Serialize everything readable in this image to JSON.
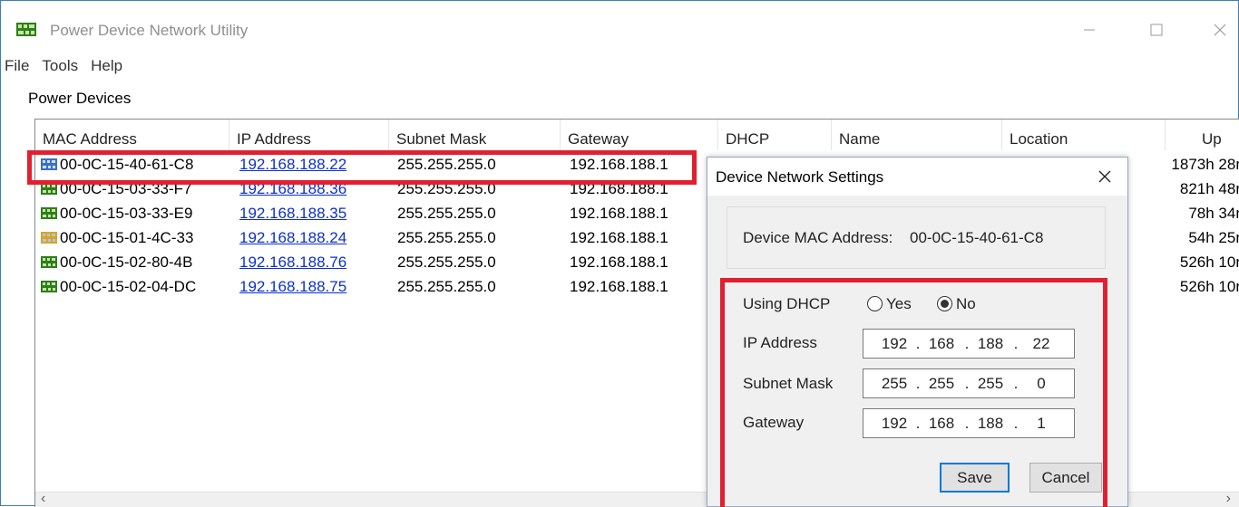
{
  "window": {
    "title": "Power Device Network Utility"
  },
  "menu": [
    "File",
    "Tools",
    "Help"
  ],
  "group_label": "Power Devices",
  "columns": [
    "MAC Address",
    "IP Address",
    "Subnet Mask",
    "Gateway",
    "DHCP",
    "Name",
    "Location",
    "Up"
  ],
  "rows": [
    {
      "mac": "00-0C-15-40-61-C8",
      "ip": "192.168.188.22",
      "subnet": "255.255.255.0",
      "gateway": "192.168.188.1",
      "uptime": "1873h 28r",
      "icon": "blue-device-icon"
    },
    {
      "mac": "00-0C-15-03-33-F7",
      "ip": "192.168.188.36",
      "subnet": "255.255.255.0",
      "gateway": "192.168.188.1",
      "uptime": "821h 48r",
      "icon": "green-device-icon"
    },
    {
      "mac": "00-0C-15-03-33-E9",
      "ip": "192.168.188.35",
      "subnet": "255.255.255.0",
      "gateway": "192.168.188.1",
      "uptime": "78h 34r",
      "icon": "green-device-icon"
    },
    {
      "mac": "00-0C-15-01-4C-33",
      "ip": "192.168.188.24",
      "subnet": "255.255.255.0",
      "gateway": "192.168.188.1",
      "uptime": "54h 25r",
      "icon": "yellow-device-icon"
    },
    {
      "mac": "00-0C-15-02-80-4B",
      "ip": "192.168.188.76",
      "subnet": "255.255.255.0",
      "gateway": "192.168.188.1",
      "uptime": "526h 10r",
      "icon": "green-device-icon"
    },
    {
      "mac": "00-0C-15-02-04-DC",
      "ip": "192.168.188.75",
      "subnet": "255.255.255.0",
      "gateway": "192.168.188.1",
      "uptime": "526h 10r",
      "icon": "green-device-icon"
    }
  ],
  "dialog": {
    "title": "Device Network Settings",
    "mac_label": "Device MAC Address:",
    "mac_value": "00-0C-15-40-61-C8",
    "dhcp_label": "Using DHCP",
    "dhcp_yes": "Yes",
    "dhcp_no": "No",
    "dhcp_selected": "No",
    "ip_label": "IP Address",
    "ip": [
      "192",
      "168",
      "188",
      "22"
    ],
    "subnet_label": "Subnet Mask",
    "subnet": [
      "255",
      "255",
      "255",
      "0"
    ],
    "gateway_label": "Gateway",
    "gateway": [
      "192",
      "168",
      "188",
      "1"
    ],
    "save_label": "Save",
    "cancel_label": "Cancel"
  },
  "colors": {
    "highlight": "#e02030",
    "link": "#0c2fd0",
    "window_border": "#3c7fb1"
  }
}
